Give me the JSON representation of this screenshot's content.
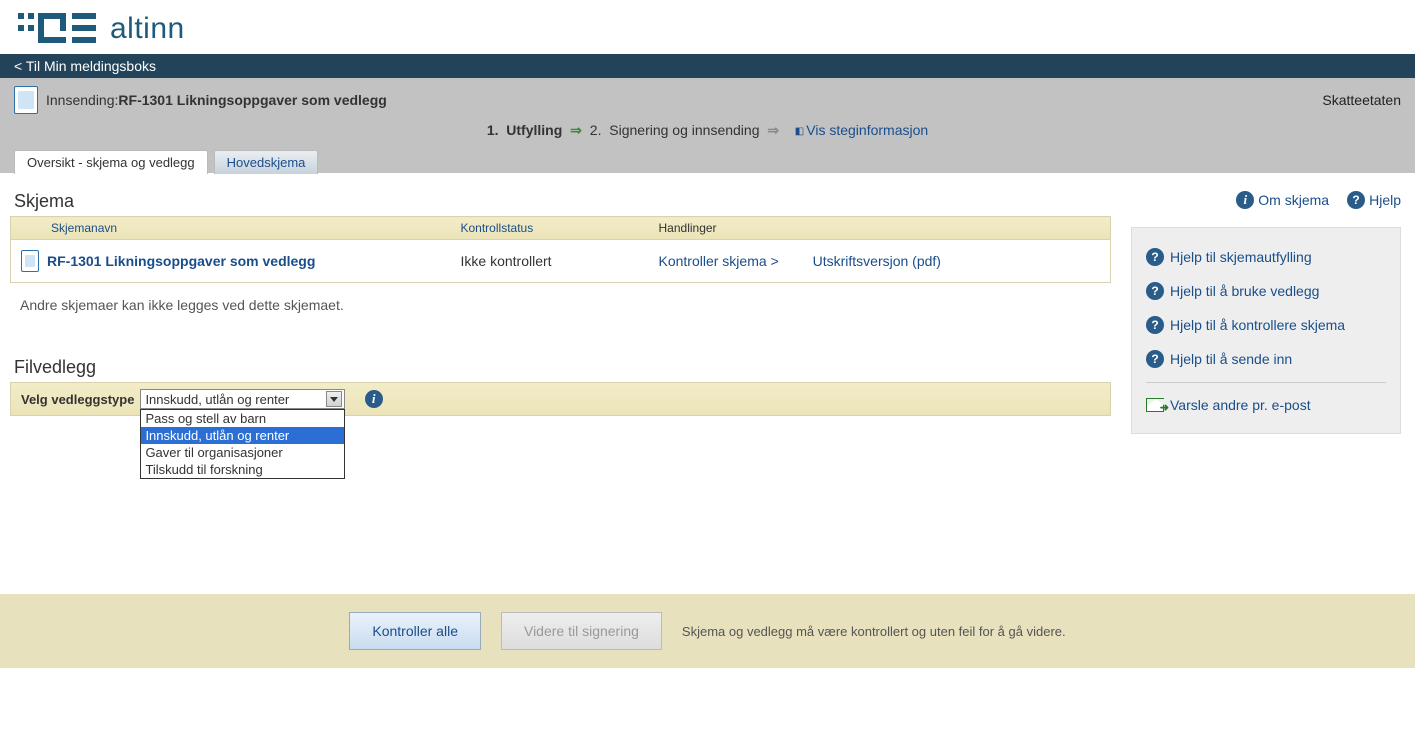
{
  "logo_text": "altinn",
  "back_link": "Til Min meldingsboks",
  "header": {
    "prefix": "Innsending:",
    "title": "RF-1301 Likningsoppgaver som vedlegg",
    "agency": "Skatteetaten"
  },
  "steps": {
    "step1_num": "1.",
    "step1": "Utfylling",
    "step2_num": "2.",
    "step2": "Signering og innsending",
    "info_link": "Vis steginformasjon"
  },
  "tabs": {
    "overview": "Oversikt - skjema og vedlegg",
    "main": "Hovedskjema"
  },
  "top_links": {
    "about": "Om skjema",
    "help": "Hjelp"
  },
  "skjema": {
    "heading": "Skjema",
    "col_name": "Skjemanavn",
    "col_status": "Kontrollstatus",
    "col_actions": "Handlinger",
    "row": {
      "name": "RF-1301 Likningsoppgaver som vedlegg",
      "status": "Ikke kontrollert",
      "action1": "Kontroller skjema >",
      "action2": "Utskriftsversjon (pdf)"
    },
    "note": "Andre skjemaer kan ikke legges ved dette skjemaet."
  },
  "filvedlegg": {
    "heading": "Filvedlegg",
    "label": "Velg vedleggstype",
    "selected": "Innskudd, utlån og renter",
    "options": [
      "Pass og stell av barn",
      "Innskudd, utlån og renter",
      "Gaver til organisasjoner",
      "Tilskudd til forskning"
    ]
  },
  "side": {
    "help1": "Hjelp til skjemautfylling",
    "help2": "Hjelp til å bruke vedlegg",
    "help3": "Hjelp til å kontrollere skjema",
    "help4": "Hjelp til å sende inn",
    "notify": "Varsle andre pr. e-post"
  },
  "footer": {
    "btn_check": "Kontroller alle",
    "btn_next": "Videre til signering",
    "note": "Skjema og vedlegg må være kontrollert og uten feil for å gå videre."
  }
}
